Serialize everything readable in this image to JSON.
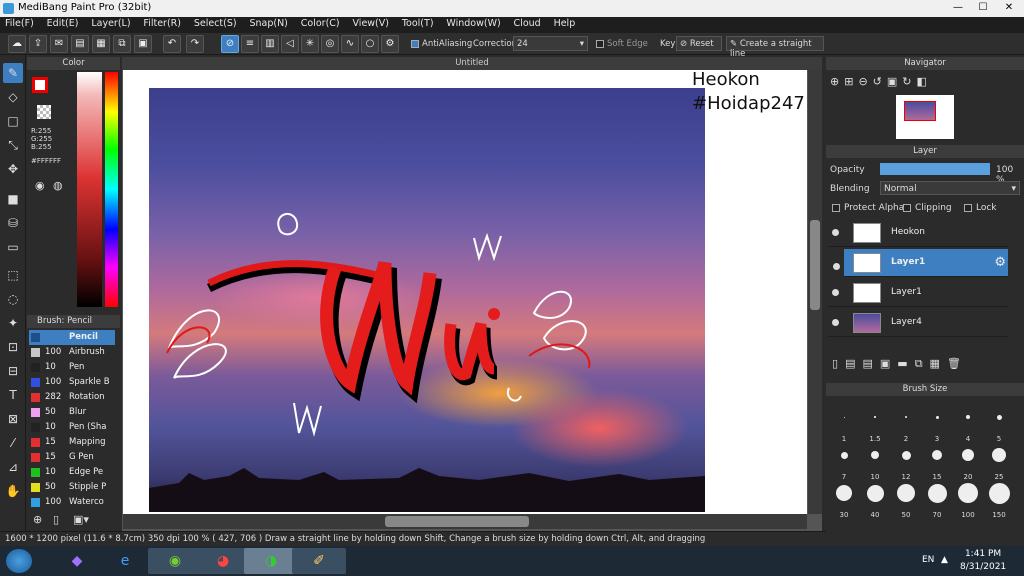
{
  "window": {
    "title": "MediBang Paint Pro (32bit)",
    "minimize": "—",
    "maximize": "☐",
    "close": "✕"
  },
  "menu": [
    "File(F)",
    "Edit(E)",
    "Layer(L)",
    "Filter(R)",
    "Select(S)",
    "Snap(N)",
    "Color(C)",
    "View(V)",
    "Tool(T)",
    "Window(W)",
    "Cloud",
    "Help"
  ],
  "toolbar": {
    "antialiasing_label": "AntiAliasing",
    "correction_label": "Correction",
    "correction_value": "24",
    "soft_edge_label": "Soft Edge",
    "key_label": "Key",
    "reset_label": "Reset",
    "straight_line_label": "Create a straight line"
  },
  "color_panel": {
    "title": "Color",
    "r": "R:255",
    "g": "G:255",
    "b": "B:255",
    "hex": "#FFFFFF"
  },
  "brush_panel": {
    "title": "Brush: Pencil",
    "items": [
      {
        "size": "",
        "name": "Pencil",
        "color": "#1e4f8a"
      },
      {
        "size": "100",
        "name": "Airbrush",
        "color": "#c8c8c8"
      },
      {
        "size": "10",
        "name": "Pen",
        "color": "#222222"
      },
      {
        "size": "100",
        "name": "Sparkle B",
        "color": "#3050e0"
      },
      {
        "size": "282",
        "name": "Rotation",
        "color": "#e03030"
      },
      {
        "size": "50",
        "name": "Blur",
        "color": "#f0a0f0"
      },
      {
        "size": "10",
        "name": "Pen (Sha",
        "color": "#222222"
      },
      {
        "size": "15",
        "name": "Mapping",
        "color": "#e03030"
      },
      {
        "size": "15",
        "name": "G Pen",
        "color": "#e03030"
      },
      {
        "size": "10",
        "name": "Edge Pe",
        "color": "#20c020"
      },
      {
        "size": "50",
        "name": "Stipple P",
        "color": "#e0e020"
      },
      {
        "size": "100",
        "name": "Waterco",
        "color": "#30a0e0"
      }
    ]
  },
  "document": {
    "tab_title": "Untitled",
    "overlay_line1": "Heokon",
    "overlay_line2": "#Hoidap247"
  },
  "status": {
    "text": "1600 * 1200 pixel   (11.6 * 8.7cm)   350 dpi   100 %   ( 427, 706 )   Draw a straight line by holding down Shift, Change a brush size by holding down Ctrl, Alt, and dragging"
  },
  "navigator": {
    "title": "Navigator"
  },
  "layer_panel": {
    "title": "Layer",
    "opacity_label": "Opacity",
    "opacity_value": "100 %",
    "opacity_level": 1.0,
    "blending_label": "Blending",
    "blending_value": "Normal",
    "protect_alpha": "Protect Alpha",
    "clipping": "Clipping",
    "lock": "Lock",
    "layers": [
      {
        "name": "Heokon",
        "selected": false
      },
      {
        "name": "Layer1",
        "selected": true
      },
      {
        "name": "Layer1",
        "selected": false
      },
      {
        "name": "Layer4",
        "selected": false
      }
    ]
  },
  "brush_size": {
    "title": "Brush Size",
    "sizes": [
      "1",
      "1.5",
      "2",
      "3",
      "4",
      "5",
      "7",
      "10",
      "12",
      "15",
      "20",
      "25",
      "30",
      "40",
      "50",
      "70",
      "100",
      "150"
    ]
  },
  "taskbar": {
    "lang": "EN",
    "time": "1:41 PM",
    "date": "8/31/2021"
  }
}
